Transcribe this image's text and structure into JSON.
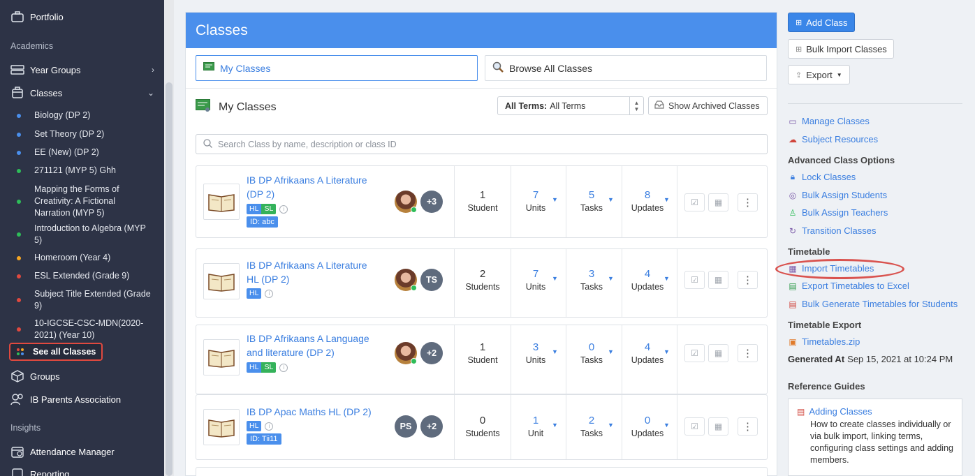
{
  "sidebar": {
    "top_item": "Portfolio",
    "section_academics": "Academics",
    "year_groups": "Year Groups",
    "classes": "Classes",
    "class_items": [
      {
        "label": "Biology (DP 2)",
        "color": "#4a8fec"
      },
      {
        "label": "Set Theory (DP 2)",
        "color": "#4a8fec"
      },
      {
        "label": "EE (New) (DP 2)",
        "color": "#4a8fec"
      },
      {
        "label": "271121 (MYP 5) Ghh",
        "color": "#2ebd59"
      },
      {
        "label": "Mapping the Forms of Creativity: A Fictional Narration (MYP 5)",
        "color": "#2ebd59"
      },
      {
        "label": "Introduction to Algebra (MYP 5)",
        "color": "#2ebd59"
      },
      {
        "label": "Homeroom (Year 4)",
        "color": "#f5a623"
      },
      {
        "label": "ESL Extended (Grade 9)",
        "color": "#e0493f"
      },
      {
        "label": "Subject Title Extended (Grade 9)",
        "color": "#e0493f"
      },
      {
        "label": "10-IGCSE-CSC-MDN(2020-2021) (Year 10)",
        "color": "#e0493f"
      }
    ],
    "see_all": "See all Classes",
    "groups": "Groups",
    "parents": "IB Parents Association",
    "section_insights": "Insights",
    "attendance": "Attendance Manager",
    "reporting": "Reporting"
  },
  "main": {
    "title": "Classes",
    "tab_my": "My Classes",
    "tab_browse": "Browse All Classes",
    "section_title": "My Classes",
    "term_select_label": "All Terms:",
    "term_select_value": "All Terms",
    "archived_btn": "Show Archived Classes",
    "search_placeholder": "Search Class by name, description or class ID"
  },
  "classes": [
    {
      "name": "IB DP Afrikaans A Literature (DP 2)",
      "levels": [
        "HL",
        "SL"
      ],
      "id": "ID: abc",
      "extra": "+3",
      "second_avatar": "",
      "students": "1",
      "students_label": "Student",
      "units": "7",
      "units_label": "Units",
      "tasks": "5",
      "tasks_label": "Tasks",
      "updates": "8",
      "updates_label": "Updates"
    },
    {
      "name": "IB DP Afrikaans A Literature HL (DP 2)",
      "levels": [
        "HL"
      ],
      "id": "",
      "extra": "TS",
      "second_avatar": "",
      "students": "2",
      "students_label": "Students",
      "units": "7",
      "units_label": "Units",
      "tasks": "3",
      "tasks_label": "Tasks",
      "updates": "4",
      "updates_label": "Updates"
    },
    {
      "name": "IB DP Afrikaans A Language and literature (DP 2)",
      "levels": [
        "HL",
        "SL"
      ],
      "id": "",
      "extra": "+2",
      "second_avatar": "",
      "students": "1",
      "students_label": "Student",
      "units": "3",
      "units_label": "Units",
      "tasks": "0",
      "tasks_label": "Tasks",
      "updates": "4",
      "updates_label": "Updates"
    },
    {
      "name": "IB DP Apac Maths HL (DP 2)",
      "levels": [
        "HL"
      ],
      "id": "ID: Tii11",
      "extra": "+2",
      "second_avatar": "PS",
      "students": "0",
      "students_label": "Students",
      "units": "1",
      "units_label": "Unit",
      "tasks": "2",
      "tasks_label": "Tasks",
      "updates": "0",
      "updates_label": "Updates"
    }
  ],
  "right": {
    "add_class": "Add Class",
    "bulk_import": "Bulk Import Classes",
    "export": "Export",
    "manage_classes": "Manage Classes",
    "subject_resources": "Subject Resources",
    "advanced_head": "Advanced Class Options",
    "lock_classes": "Lock Classes",
    "bulk_assign_students": "Bulk Assign Students",
    "bulk_assign_teachers": "Bulk Assign Teachers",
    "transition_classes": "Transition Classes",
    "timetable_head": "Timetable",
    "import_timetables": "Import Timetables",
    "export_timetables": "Export Timetables to Excel",
    "bulk_generate": "Bulk Generate Timetables for Students",
    "timetable_export_head": "Timetable Export",
    "timetables_zip": "Timetables.zip",
    "generated_label": "Generated At",
    "generated_value": "Sep 15, 2021 at 10:24 PM",
    "guides_head": "Reference Guides",
    "guide_title": "Adding Classes",
    "guide_desc": "How to create classes individually or via bulk import, linking terms, configuring class settings and adding members."
  },
  "colors": {
    "accent": "#4a8fec",
    "sidebar": "#2d3346",
    "highlight": "#e0493f"
  }
}
